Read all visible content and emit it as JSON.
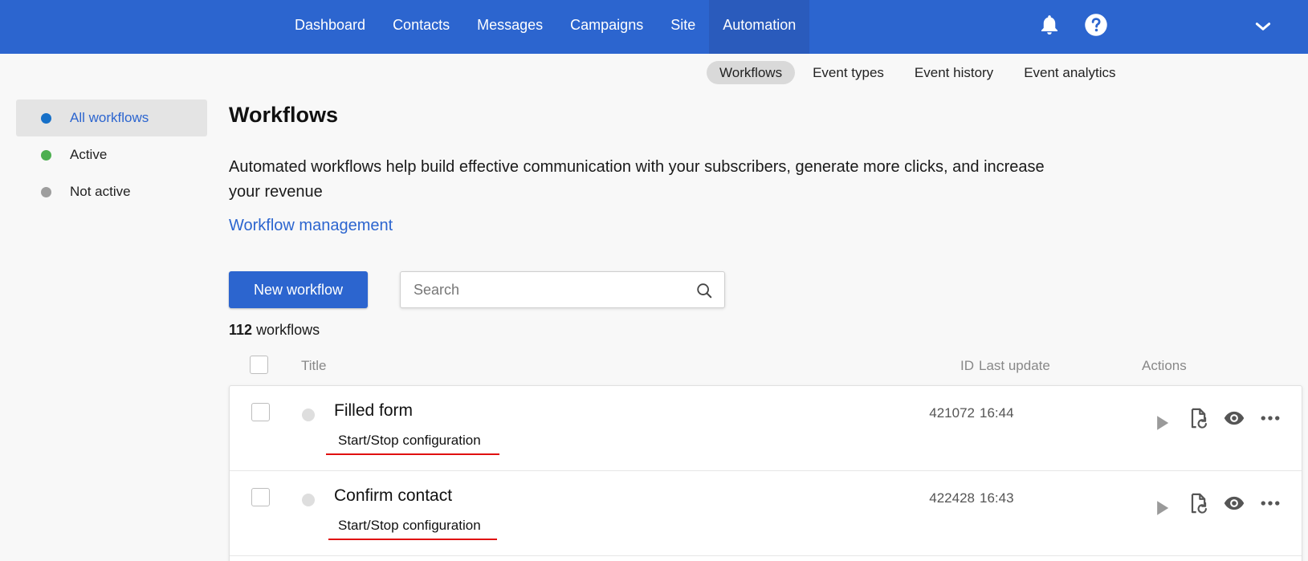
{
  "topnav": {
    "items": [
      {
        "label": "Dashboard"
      },
      {
        "label": "Contacts"
      },
      {
        "label": "Messages"
      },
      {
        "label": "Campaigns"
      },
      {
        "label": "Site"
      },
      {
        "label": "Automation",
        "active": true
      }
    ],
    "icons": [
      "bell-icon",
      "help-icon",
      "chevron-down-icon"
    ]
  },
  "subtabs": [
    {
      "label": "Workflows",
      "active": true
    },
    {
      "label": "Event types"
    },
    {
      "label": "Event history"
    },
    {
      "label": "Event analytics"
    }
  ],
  "sidebar": {
    "items": [
      {
        "label": "All workflows",
        "dot_color": "#1670c8",
        "active": true
      },
      {
        "label": "Active",
        "dot_color": "#4caf50"
      },
      {
        "label": "Not active",
        "dot_color": "#9e9e9e"
      }
    ]
  },
  "main": {
    "title": "Workflows",
    "description": "Automated workflows help build effective communication with your subscribers, generate more clicks, and increase your revenue",
    "link": "Workflow management",
    "new_button": "New workflow",
    "search_placeholder": "Search",
    "count_number": "112",
    "count_label": "workflows"
  },
  "table": {
    "columns": {
      "title": "Title",
      "id": "ID",
      "last_update": "Last update",
      "actions": "Actions"
    },
    "rows": [
      {
        "title": "Filled form",
        "tag": "Start/Stop configuration",
        "id": "421072",
        "last_update": "16:44"
      },
      {
        "title": "Confirm contact",
        "tag": "Start/Stop configuration",
        "id": "422428",
        "last_update": "16:43"
      }
    ],
    "row_action_icons": [
      "play-icon",
      "file-refresh-icon",
      "eye-icon",
      "more-icon"
    ]
  },
  "colors": {
    "brand": "#2c65cf",
    "annotation": "#e01010"
  }
}
